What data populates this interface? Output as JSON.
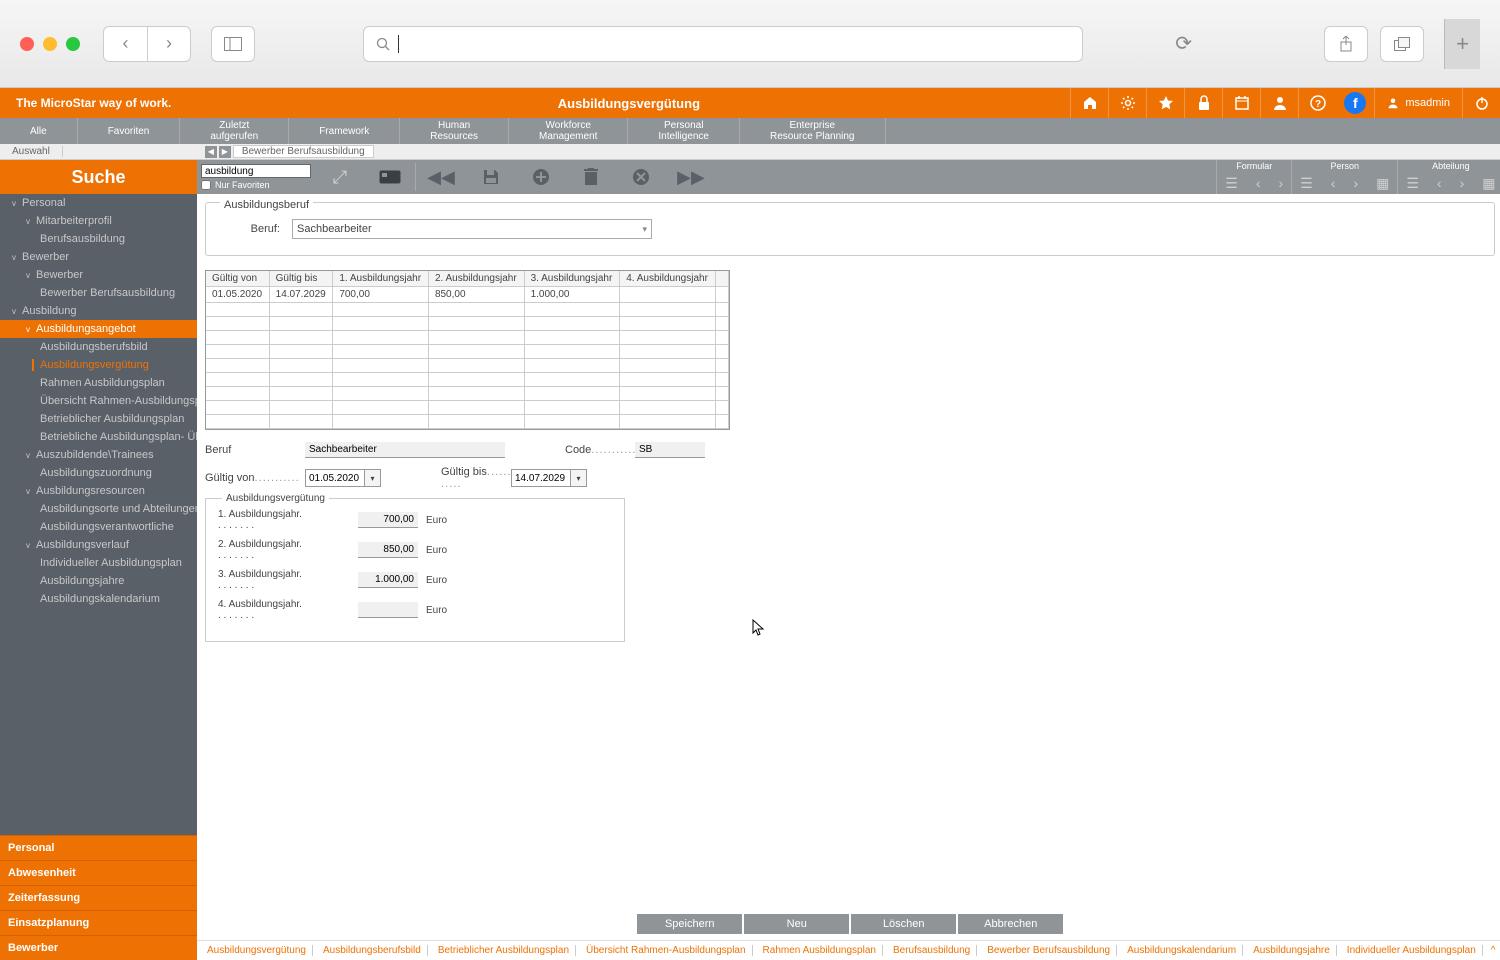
{
  "browser": {
    "search_placeholder": ""
  },
  "header": {
    "tagline": "The MicroStar way of work.",
    "title": "Ausbildungsvergütung",
    "user": "msadmin"
  },
  "nav": [
    "Alle",
    "Favoriten",
    "Zuletzt\naufgerufen",
    "Framework",
    "Human\nResources",
    "Workforce\nManagement",
    "Personal\nIntelligence",
    "Enterprise\nResource Planning"
  ],
  "breadcrumb": {
    "auswahl": "Auswahl",
    "page": "Bewerber Berufsausbildung"
  },
  "sidebar": {
    "search_header": "Suche",
    "tree": [
      {
        "label": "Personal",
        "lvl": 1,
        "caret": true
      },
      {
        "label": "Mitarbeiterprofil",
        "lvl": 2,
        "caret": true
      },
      {
        "label": "Berufsausbildung",
        "lvl": 3
      },
      {
        "label": "Bewerber",
        "lvl": 1,
        "caret": true
      },
      {
        "label": "Bewerber",
        "lvl": 2,
        "caret": true
      },
      {
        "label": "Bewerber Berufsausbildung",
        "lvl": 3
      },
      {
        "label": "Ausbildung",
        "lvl": 1,
        "caret": true
      },
      {
        "label": "Ausbildungsangebot",
        "lvl": 2,
        "caret": true,
        "active": true
      },
      {
        "label": "Ausbildungsberufsbild",
        "lvl": 3
      },
      {
        "label": "Ausbildungsvergütung",
        "lvl": 3,
        "selected": true
      },
      {
        "label": "Rahmen Ausbildungsplan",
        "lvl": 3
      },
      {
        "label": "Übersicht Rahmen-Ausbildungsplan",
        "lvl": 3
      },
      {
        "label": "Betrieblicher Ausbildungsplan",
        "lvl": 3
      },
      {
        "label": "Betriebliche Ausbildungsplan- Übersic",
        "lvl": 3
      },
      {
        "label": "Auszubildende\\Trainees",
        "lvl": 2,
        "caret": true
      },
      {
        "label": "Ausbildungszuordnung",
        "lvl": 3
      },
      {
        "label": "Ausbildungsresourcen",
        "lvl": 2,
        "caret": true
      },
      {
        "label": "Ausbildungsorte und Abteilungen",
        "lvl": 3
      },
      {
        "label": "Ausbildungsverantwortliche",
        "lvl": 3
      },
      {
        "label": "Ausbildungsverlauf",
        "lvl": 2,
        "caret": true
      },
      {
        "label": "Individueller Ausbildungsplan",
        "lvl": 3
      },
      {
        "label": "Ausbildungsjahre",
        "lvl": 3
      },
      {
        "label": "Ausbildungskalendarium",
        "lvl": 3
      }
    ],
    "bottom": [
      "Personal",
      "Abwesenheit",
      "Zeiterfassung",
      "Einsatzplanung",
      "Bewerber"
    ]
  },
  "toolbar": {
    "search_value": "ausbildung",
    "fav_label": "Nur Favoriten",
    "sections": [
      {
        "label": "Formular",
        "controls": [
          "list",
          "prev",
          "next"
        ]
      },
      {
        "label": "Person",
        "controls": [
          "list",
          "prev",
          "next",
          "grid"
        ]
      },
      {
        "label": "Abteilung",
        "controls": [
          "list",
          "prev",
          "next",
          "grid"
        ]
      }
    ]
  },
  "form": {
    "fieldset_legend": "Ausbildungsberuf",
    "beruf_label": "Beruf:",
    "beruf_value": "Sachbearbeiter"
  },
  "table": {
    "headers": [
      "Gültig von",
      "Gültig bis",
      "1. Ausbildungsjahr",
      "2. Ausbildungsjahr",
      "3. Ausbildungsjahr",
      "4. Ausbildungsjahr"
    ],
    "rows": [
      [
        "01.05.2020",
        "14.07.2029",
        "700,00",
        "850,00",
        "1.000,00",
        ""
      ]
    ]
  },
  "detail": {
    "beruf_label": "Beruf",
    "beruf_value": "Sachbearbeiter",
    "code_label": "Code",
    "code_value": "SB",
    "von_label": "Gültig von",
    "von_value": "01.05.2020",
    "bis_label": "Gültig bis",
    "bis_value": "14.07.2029",
    "av_legend": "Ausbildungsvergütung",
    "years": [
      {
        "label": "1. Ausbildungsjahr.",
        "value": "700,00",
        "unit": "Euro"
      },
      {
        "label": "2. Ausbildungsjahr.",
        "value": "850,00",
        "unit": "Euro"
      },
      {
        "label": "3. Ausbildungsjahr.",
        "value": "1.000,00",
        "unit": "Euro"
      },
      {
        "label": "4. Ausbildungsjahr.",
        "value": "",
        "unit": "Euro"
      }
    ]
  },
  "actions": [
    "Speichern",
    "Neu",
    "Löschen",
    "Abbrechen"
  ],
  "footer": [
    "Ausbildungsvergütung",
    "Ausbildungsberufsbild",
    "Betrieblicher Ausbildungsplan",
    "Übersicht Rahmen-Ausbildungsplan",
    "Rahmen Ausbildungsplan",
    "Berufsausbildung",
    "Bewerber Berufsausbildung",
    "Ausbildungskalendarium",
    "Ausbildungsjahre",
    "Individueller Ausbildungsplan"
  ]
}
